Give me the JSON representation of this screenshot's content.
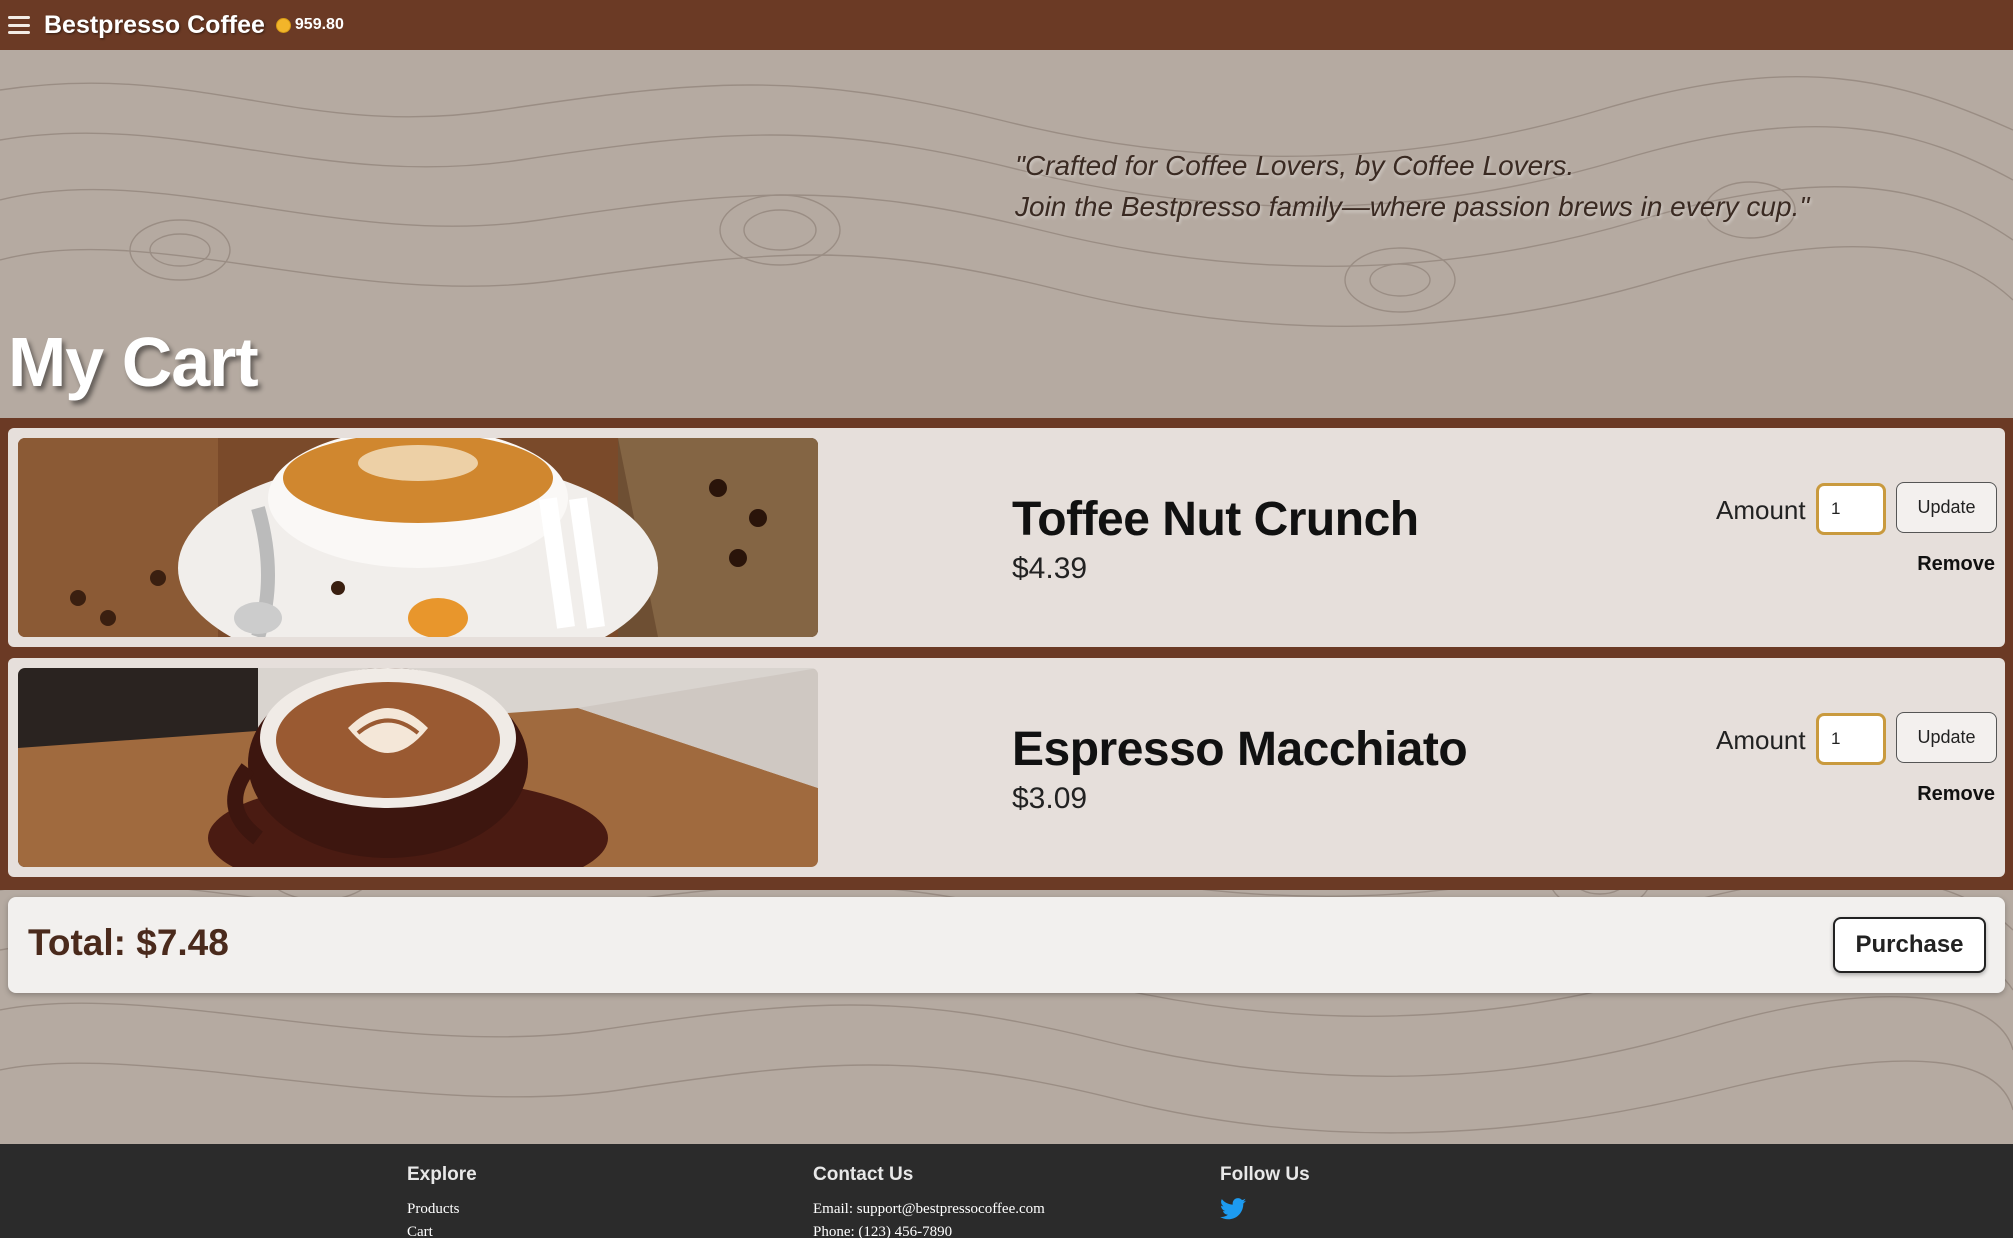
{
  "header": {
    "brand": "Bestpresso Coffee",
    "balance": "959.80",
    "menu_icon": "hamburger-menu-icon",
    "coin_icon": "coin-icon"
  },
  "hero": {
    "quote_line1": "\"Crafted for Coffee Lovers, by Coffee Lovers.",
    "quote_line2": "Join the Bestpresso family—where passion brews in every cup.\""
  },
  "page": {
    "title": "My Cart"
  },
  "cart": {
    "items": [
      {
        "name": "Toffee Nut Crunch",
        "price": "$4.39",
        "amount_label": "Amount",
        "quantity": "1",
        "update_label": "Update",
        "remove_label": "Remove"
      },
      {
        "name": "Espresso Macchiato",
        "price": "$3.09",
        "amount_label": "Amount",
        "quantity": "1",
        "update_label": "Update",
        "remove_label": "Remove"
      }
    ],
    "total": "Total: $7.48",
    "purchase_label": "Purchase"
  },
  "footer": {
    "explore": {
      "heading": "Explore",
      "links": [
        "Products",
        "Cart"
      ]
    },
    "contact": {
      "heading": "Contact Us",
      "email": "Email: support@bestpressocoffee.com",
      "phone": "Phone: (123) 456-7890"
    },
    "follow": {
      "heading": "Follow Us",
      "icon": "twitter-icon"
    }
  },
  "colors": {
    "header_bg": "#6b3a25",
    "cart_frame": "#6b3a25",
    "item_bg": "#e6dfdb",
    "input_border": "#c99a3e",
    "coin": "#f2b52a",
    "footer_bg": "#2b2b2b",
    "twitter": "#1d9bf0"
  }
}
